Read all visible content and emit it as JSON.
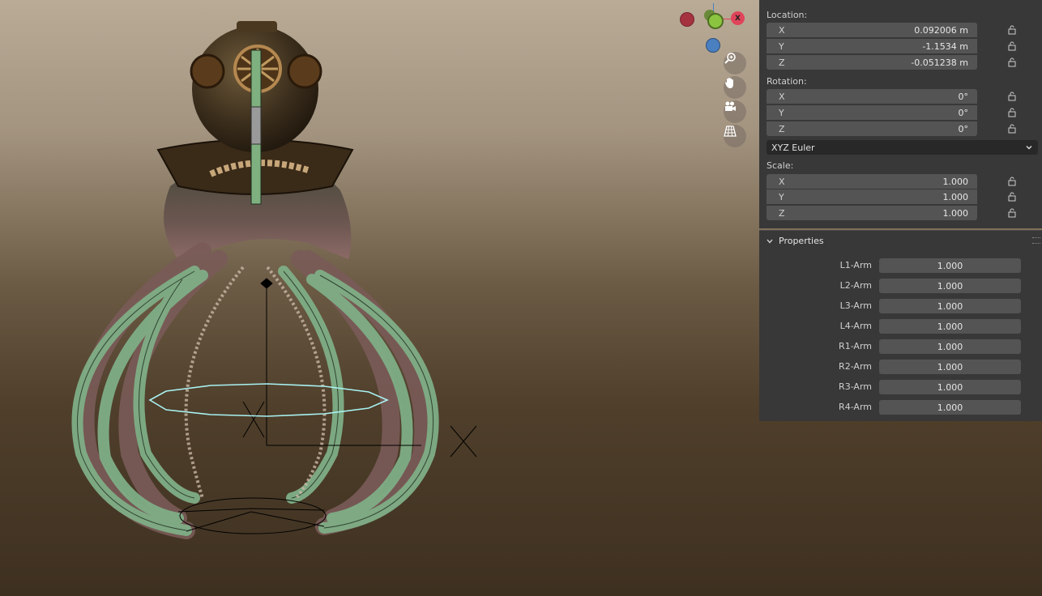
{
  "gizmo": {
    "x_label": "X",
    "colors": {
      "x": "#e0445a",
      "y": "#8bc43f",
      "z": "#4a7fc0",
      "neg_x": "#a5323f",
      "neg_z": "#3d5f8e"
    }
  },
  "nav_buttons": [
    {
      "icon": "zoom-icon"
    },
    {
      "icon": "hand-pan-icon"
    },
    {
      "icon": "camera-icon"
    },
    {
      "icon": "ortho-grid-icon"
    }
  ],
  "transform": {
    "location_label": "Location:",
    "location": [
      {
        "axis": "X",
        "value": "0.092006 m"
      },
      {
        "axis": "Y",
        "value": "-1.1534 m"
      },
      {
        "axis": "Z",
        "value": "-0.051238 m"
      }
    ],
    "rotation_label": "Rotation:",
    "rotation": [
      {
        "axis": "X",
        "value": "0°"
      },
      {
        "axis": "Y",
        "value": "0°"
      },
      {
        "axis": "Z",
        "value": "0°"
      }
    ],
    "rotation_mode": "XYZ Euler",
    "scale_label": "Scale:",
    "scale": [
      {
        "axis": "X",
        "value": "1.000"
      },
      {
        "axis": "Y",
        "value": "1.000"
      },
      {
        "axis": "Z",
        "value": "1.000"
      }
    ]
  },
  "properties": {
    "header": "Properties",
    "items": [
      {
        "label": "L1-Arm",
        "value": "1.000"
      },
      {
        "label": "L2-Arm",
        "value": "1.000"
      },
      {
        "label": "L3-Arm",
        "value": "1.000"
      },
      {
        "label": "L4-Arm",
        "value": "1.000"
      },
      {
        "label": "R1-Arm",
        "value": "1.000"
      },
      {
        "label": "R2-Arm",
        "value": "1.000"
      },
      {
        "label": "R3-Arm",
        "value": "1.000"
      },
      {
        "label": "R4-Arm",
        "value": "1.000"
      }
    ]
  }
}
